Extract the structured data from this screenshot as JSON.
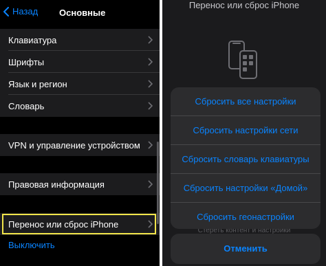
{
  "left": {
    "nav": {
      "back_label": "Назад",
      "title": "Основные"
    },
    "group1": [
      "Клавиатура",
      "Шрифты",
      "Язык и регион",
      "Словарь"
    ],
    "group2": [
      "VPN и управление устройством"
    ],
    "group3": [
      "Правовая информация"
    ],
    "group4": [
      "Перенос или сброс iPhone"
    ],
    "shutdown_label": "Выключить"
  },
  "right": {
    "title": "Перенос или сброс iPhone",
    "actions": [
      "Сбросить все настройки",
      "Сбросить настройки сети",
      "Сбросить словарь клавиатуры",
      "Сбросить настройки «Домой»",
      "Сбросить геонастройки"
    ],
    "under_text": "Стереть контент и настройки",
    "cancel_label": "Отменить"
  },
  "colors": {
    "accent": "#0a84ff",
    "highlight": "#f2e54a",
    "cell": "#1c1c1e",
    "sheet": "#2c2c2e"
  }
}
